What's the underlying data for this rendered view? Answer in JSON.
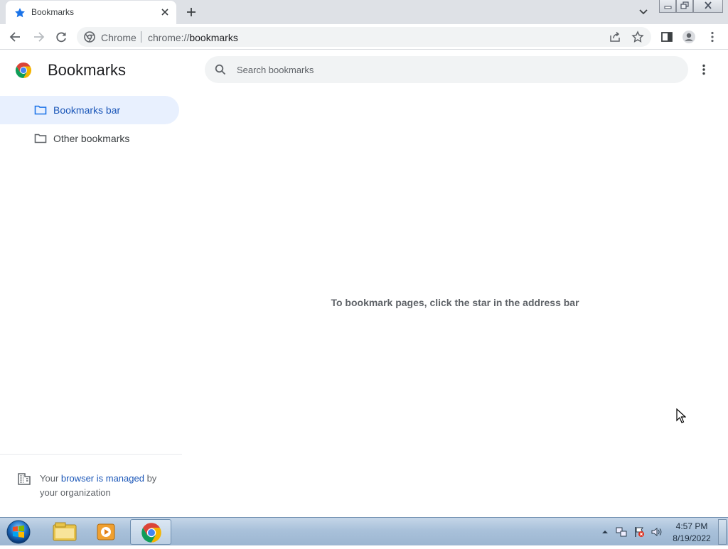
{
  "tab": {
    "title": "Bookmarks",
    "favicon": "star-icon",
    "close": "close-icon"
  },
  "tabstrip": {
    "new_tab": "plus-icon",
    "tab_search": "chevron-down-icon",
    "window_controls": [
      "minimize-icon",
      "restore-icon",
      "close-icon"
    ]
  },
  "toolbar": {
    "back": "back-arrow-icon",
    "forward": "forward-arrow-icon",
    "reload": "reload-icon",
    "omnibox": {
      "site_chip": "Chrome",
      "url_scheme": "chrome://",
      "url_host": "bookmarks",
      "site_icon": "chrome-icon",
      "share": "share-icon",
      "star": "star-outline-icon"
    },
    "side_panel": "side-panel-icon",
    "profile": "profile-icon",
    "menu": "kebab-menu-icon"
  },
  "page": {
    "title": "Bookmarks",
    "logo": "chrome-logo-icon",
    "search_placeholder": "Search bookmarks",
    "search_value": "",
    "more_menu": "kebab-menu-icon"
  },
  "sidebar": {
    "items": [
      {
        "label": "Bookmarks bar",
        "icon": "folder-icon",
        "selected": true
      },
      {
        "label": "Other bookmarks",
        "icon": "folder-icon",
        "selected": false
      }
    ],
    "managed": {
      "prefix": "Your ",
      "link": "browser is managed",
      "suffix": " by your organization",
      "icon": "building-icon"
    }
  },
  "main": {
    "empty_message": "To bookmark pages, click the star in the address bar"
  },
  "taskbar": {
    "start": "windows-start-icon",
    "items": [
      {
        "name": "file-explorer",
        "icon": "folder-explorer-icon",
        "active": false
      },
      {
        "name": "media-player",
        "icon": "media-player-icon",
        "active": false
      },
      {
        "name": "chrome",
        "icon": "chrome-icon",
        "active": true
      }
    ],
    "tray": {
      "icons": [
        "tray-overflow-icon",
        "network-icon",
        "action-center-icon",
        "volume-icon"
      ],
      "time": "4:57 PM",
      "date": "8/19/2022"
    }
  },
  "colors": {
    "accent": "#1a73e8",
    "selected_bg": "#e8f0fe",
    "selected_text": "#1a56b8",
    "tabstrip_bg": "#dee1e6",
    "omnibox_bg": "#f1f3f4"
  }
}
